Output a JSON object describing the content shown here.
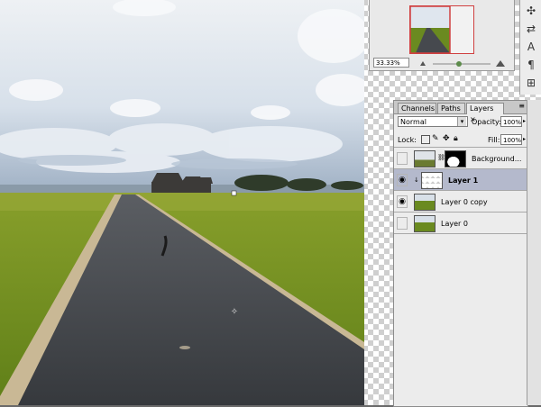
{
  "navigator": {
    "zoom": "33.33%"
  },
  "toolstrip": {
    "icons": [
      "tool-preset-icon",
      "brush-swap-icon",
      "character-icon",
      "paragraph-icon",
      "clone-source-icon"
    ],
    "glyphs": [
      "✣",
      "⇄",
      "A",
      "¶",
      "⊞"
    ]
  },
  "layers_panel": {
    "tabs": [
      "Channels",
      "Paths",
      "Layers"
    ],
    "active_tab": "Layers",
    "blend_mode": "Normal",
    "opacity_label": "Opacity:",
    "opacity_value": "100%",
    "lock_label": "Lock:",
    "fill_label": "Fill:",
    "fill_value": "100%",
    "layers": [
      {
        "name": "Background...",
        "visible": false,
        "selected": false,
        "has_mask": true
      },
      {
        "name": "Layer 1",
        "visible": true,
        "selected": true,
        "clipped": true
      },
      {
        "name": "Layer 0 copy",
        "visible": true,
        "selected": false
      },
      {
        "name": "Layer 0",
        "visible": false,
        "selected": false
      }
    ]
  },
  "colors": {
    "panel_bg": "#ececec",
    "selection": "#b4b9cc",
    "sky": "#c9d6e3",
    "field": "#7b9a22",
    "road": "#3c3f44"
  }
}
